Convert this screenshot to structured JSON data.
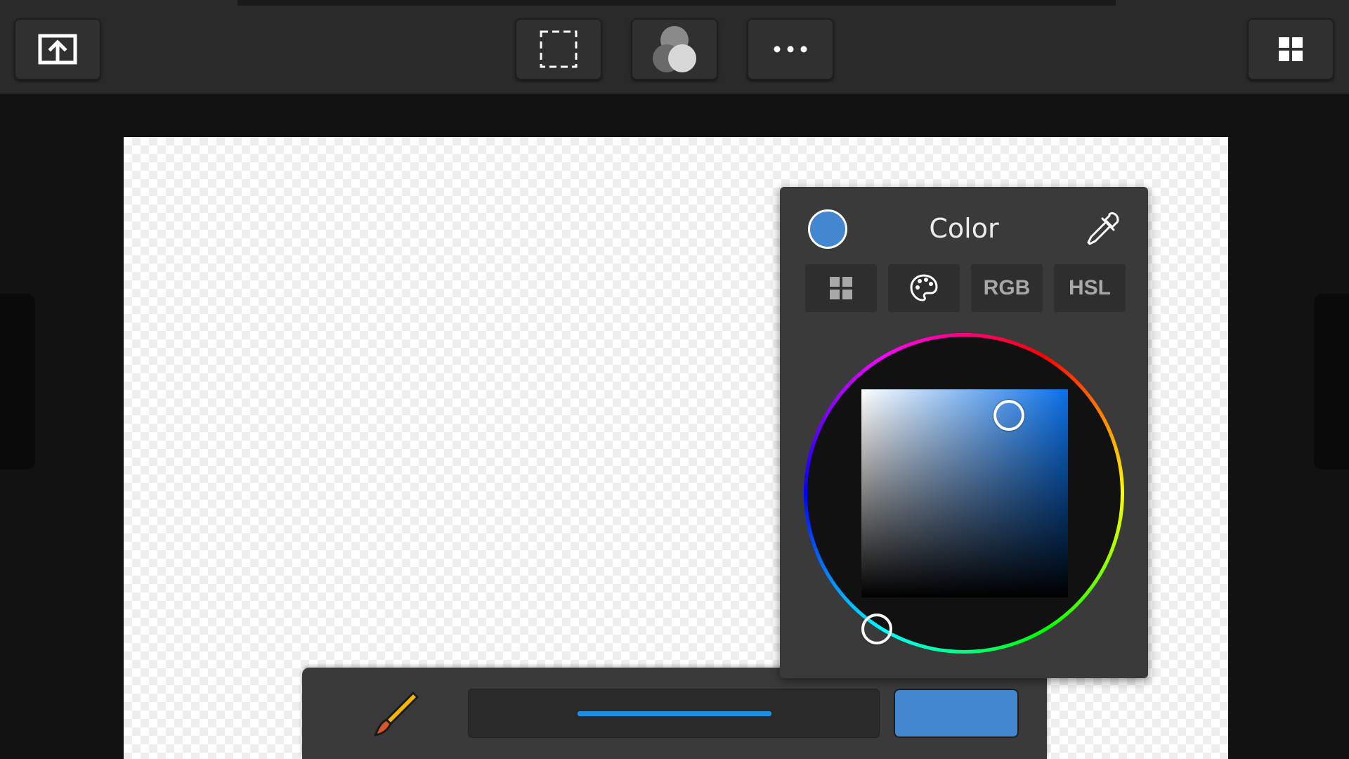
{
  "toolbar": {
    "icons": [
      "export-icon",
      "selection-icon",
      "layers-icon",
      "more-icon",
      "gallery-icon"
    ]
  },
  "color_panel": {
    "title": "Color",
    "current_color": "#4287cf",
    "tabs": [
      {
        "label": "",
        "icon": "swatches-grid-icon"
      },
      {
        "label": "",
        "icon": "palette-icon"
      },
      {
        "label": "RGB"
      },
      {
        "label": "HSL"
      }
    ],
    "hue_color": "#0a70e8"
  },
  "brushbar": {
    "brush_icon": "brush-icon",
    "stroke_color": "#1e8fe0",
    "color_button": "#4287cf"
  }
}
